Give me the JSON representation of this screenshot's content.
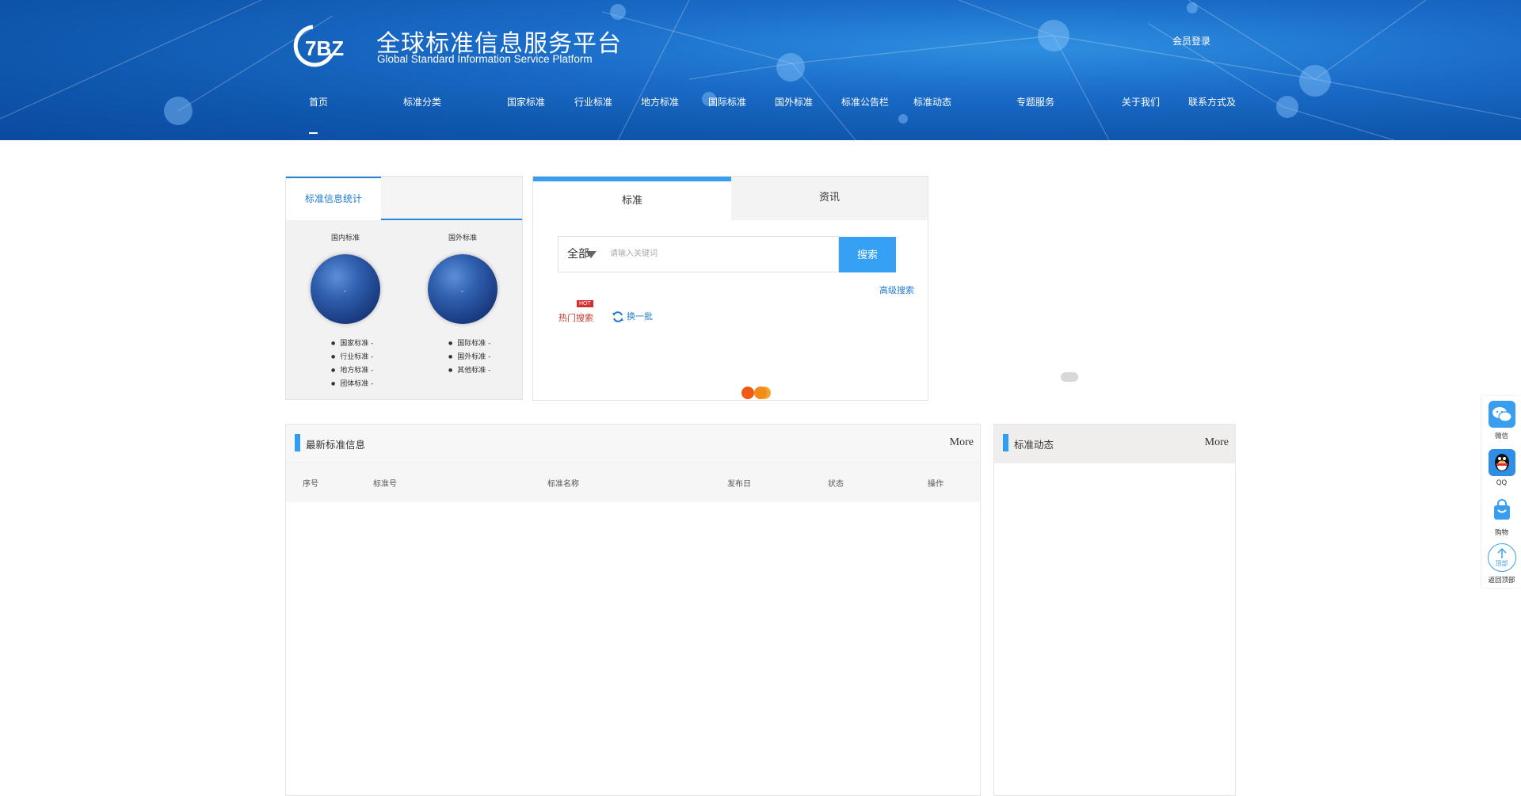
{
  "header": {
    "logo_text": "7BZ",
    "title": "全球标准信息服务平台",
    "subtitle": "Global Standard Information Service Platform",
    "top_link": "会员登录"
  },
  "nav": {
    "items": [
      {
        "label": "首页"
      },
      {
        "label": "标准分类"
      },
      {
        "label": "国家标准"
      },
      {
        "label": "行业标准"
      },
      {
        "label": "地方标准"
      },
      {
        "label": "国际标准"
      },
      {
        "label": "国外标准"
      },
      {
        "label": "标准公告栏"
      },
      {
        "label": "标准动态"
      },
      {
        "label": "专题服务"
      },
      {
        "label": "关于我们"
      },
      {
        "label": "联系方式及"
      }
    ]
  },
  "left_panel": {
    "tab_active": "标准信息统计",
    "col1": {
      "title": "国内标准",
      "globe_mark": "-",
      "items": [
        "国家标准 -",
        "行业标准 -",
        "地方标准 -",
        "团体标准 -"
      ]
    },
    "col2": {
      "title": "国外标准",
      "globe_mark": "-",
      "items": [
        "国际标准 -",
        "国外标准 -",
        "其他标准 -"
      ]
    }
  },
  "search_panel": {
    "tab_active": "标准",
    "tab_other": "资讯",
    "select_value": "全部",
    "input_placeholder": "请输入关键词",
    "button_label": "搜索",
    "advanced_link": "高级搜索",
    "hot_label": "热门搜索",
    "hot_badge": "HOT",
    "refresh_label": "换一批"
  },
  "section_left": {
    "title": "最新标准信息",
    "more": "More",
    "columns": [
      "序号",
      "标准号",
      "标准名称",
      "发布日",
      "状态",
      "操作"
    ]
  },
  "section_right": {
    "title": "标准动态",
    "more": "More"
  },
  "float_bar": {
    "items": [
      {
        "label": "微信",
        "icon": "wechat-icon"
      },
      {
        "label": "QQ",
        "icon": "qq-icon"
      },
      {
        "label": "购物",
        "icon": "shopping-bag-icon"
      },
      {
        "label": "返回顶部",
        "icon": "back-to-top-icon",
        "icon_text": "顶部"
      }
    ]
  },
  "colors": {
    "header_blue": "#0f56ad",
    "accent_blue": "#36a1f4",
    "hot_red": "#d42f2f"
  }
}
